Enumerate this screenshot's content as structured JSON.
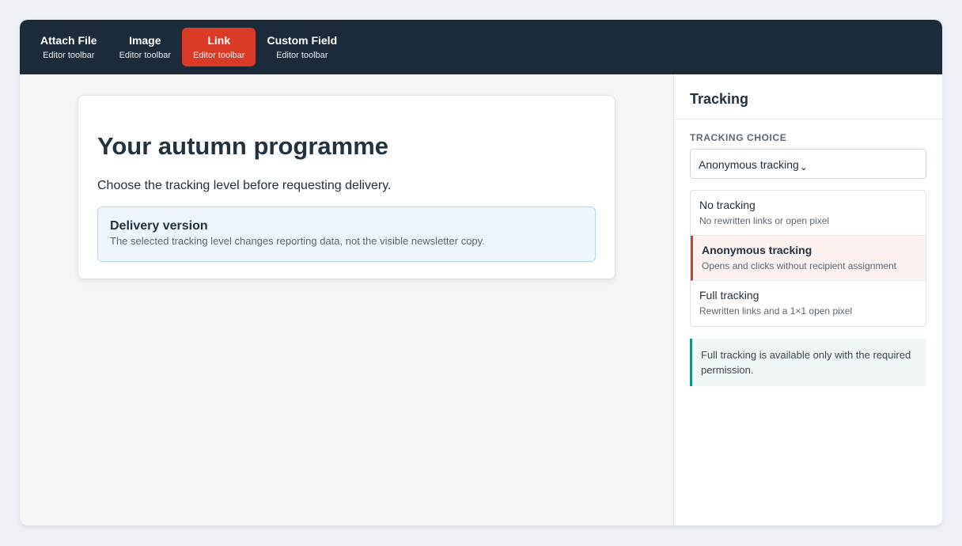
{
  "toolbar": {
    "buttons": [
      {
        "label": "Attach File",
        "sub": "Editor toolbar"
      },
      {
        "label": "Image",
        "sub": "Editor toolbar"
      },
      {
        "label": "Link",
        "sub": "Editor toolbar",
        "active": true
      },
      {
        "label": "Custom Field",
        "sub": "Editor toolbar"
      }
    ]
  },
  "main": {
    "title": "Your autumn programme",
    "intro": "Choose the tracking level before requesting delivery.",
    "callout": {
      "title": "Delivery version",
      "text": "The selected tracking level changes reporting data, not the visible newsletter copy."
    }
  },
  "panel": {
    "title": "Tracking",
    "field_label": "TRACKING CHOICE",
    "selected_value": "Anonymous tracking",
    "chevron": "⌄",
    "options": [
      {
        "title": "No tracking",
        "desc": "No rewritten links or open pixel"
      },
      {
        "title": "Anonymous tracking",
        "desc": "Opens and clicks without recipient assignment",
        "selected": true
      },
      {
        "title": "Full tracking",
        "desc": "Rewritten links and a 1×1 open pixel"
      }
    ],
    "note": "Full tracking is available only with the required permission."
  },
  "colors": {
    "toolbar_bg": "#1b2b3a",
    "accent": "#d93b27",
    "note_border": "#1b8f8a"
  }
}
